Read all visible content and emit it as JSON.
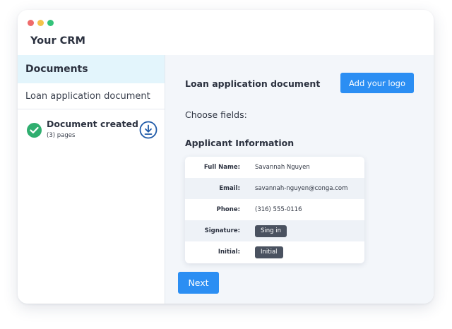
{
  "app": {
    "title": "Your CRM"
  },
  "colors": {
    "close": "#ef6b6b",
    "minimize": "#f5c24a",
    "maximize": "#34c37a",
    "primary": "#2b8ef3",
    "success": "#2fae6f",
    "pill": "#4a5260"
  },
  "sidebar": {
    "heading": "Documents",
    "items": [
      {
        "label": "Loan application document"
      }
    ],
    "document": {
      "title": "Document created",
      "subtitle": "(3) pages",
      "status_icon": "check-icon",
      "action_icon": "download-icon"
    }
  },
  "main": {
    "title": "Loan application document",
    "logo_button": "Add your logo",
    "choose_label": "Choose fields:",
    "section_title": "Applicant Information",
    "fields": [
      {
        "label": "Full Name:",
        "value": "Savannah Nguyen"
      },
      {
        "label": "Email:",
        "value": "savannah-nguyen@conga.com"
      },
      {
        "label": "Phone:",
        "value": "(316) 555-0116"
      },
      {
        "label": "Signature:",
        "button": "Sing in"
      },
      {
        "label": "Initial:",
        "button": "Initial"
      }
    ],
    "next_button": "Next"
  }
}
